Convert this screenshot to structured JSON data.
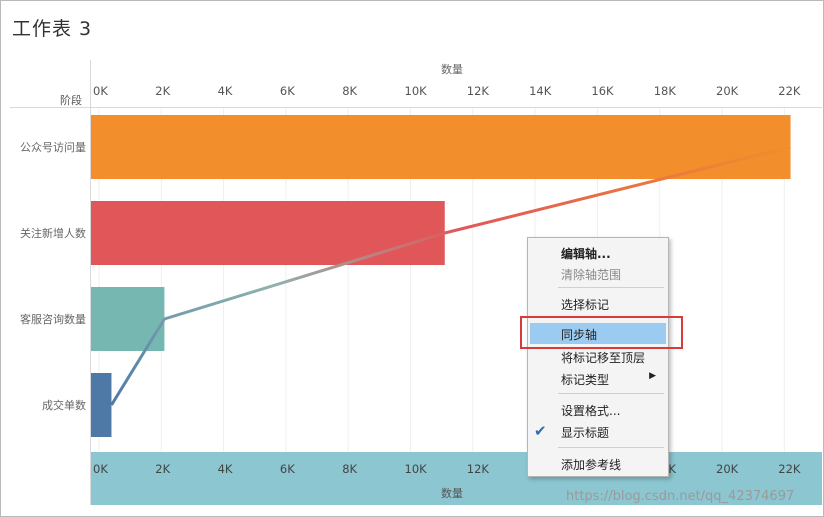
{
  "worksheet": {
    "title": "工作表 3"
  },
  "header": {
    "axis_title": "数量",
    "dimension_label": "阶段"
  },
  "axis_ticks": [
    "0K",
    "2K",
    "4K",
    "6K",
    "8K",
    "10K",
    "12K",
    "14K",
    "16K",
    "18K",
    "20K",
    "22K"
  ],
  "bottom_axis": {
    "title": "数量",
    "ticks": [
      "0K",
      "2K",
      "4K",
      "6K",
      "8K",
      "10K",
      "12K",
      "14K",
      "16K",
      "18K",
      "20K",
      "22K"
    ]
  },
  "chart_data": {
    "type": "bar",
    "categories": [
      "公众号访问量",
      "关注新增人数",
      "客服咨询数量",
      "成交单数"
    ],
    "values": [
      22200,
      11100,
      2100,
      400
    ],
    "line_values": [
      22200,
      11100,
      2100,
      400
    ],
    "xlim": [
      0,
      23500
    ],
    "colors": [
      "#f28e2b",
      "#e15759",
      "#76b7b2",
      "#4e79a7"
    ],
    "xlabel": "数量",
    "ylabel": "阶段"
  },
  "context_menu": {
    "items": [
      {
        "label": "编辑轴...",
        "bold": true
      },
      {
        "label": "清除轴范围",
        "disabled": true
      },
      {
        "label": "选择标记"
      },
      {
        "label": "同步轴",
        "highlighted": true
      },
      {
        "label": "将标记移至顶层"
      },
      {
        "label": "标记类型",
        "submenu": true
      },
      {
        "label": "设置格式..."
      },
      {
        "label": "显示标题",
        "checked": true
      },
      {
        "label": "添加参考线"
      }
    ]
  },
  "watermark": "https://blog.csdn.net/qq_42374697"
}
